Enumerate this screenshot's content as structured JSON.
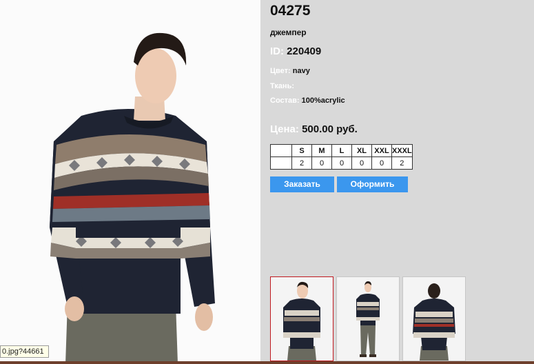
{
  "product": {
    "article": "04275",
    "subtitle": "джемпер",
    "id_label": "ID:",
    "id_value": "220409",
    "color_label": "Цвет:",
    "color_value": "navy",
    "fabric_label": "Ткань:",
    "fabric_value": "",
    "composition_label": "Состав:",
    "composition_value": "100%acrylic",
    "price_label": "Цена:",
    "price_value": "500.00 руб."
  },
  "sizes": {
    "labels": [
      "S",
      "M",
      "L",
      "XL",
      "XXL",
      "XXXL"
    ],
    "quantities": [
      "2",
      "0",
      "0",
      "0",
      "0",
      "2"
    ]
  },
  "buttons": {
    "order": "Заказать",
    "checkout": "Оформить"
  },
  "status_url": "0.jpg?44661",
  "colors": {
    "panel_bg": "#d9d9d9",
    "button_bg": "#3b97ee",
    "active_thumb_border": "#c0181f",
    "sweater_navy": "#1f2433"
  },
  "icons": {
    "main_photo": "product-photo",
    "thumbs": [
      "thumb-front-closeup",
      "thumb-front-full",
      "thumb-back"
    ]
  }
}
